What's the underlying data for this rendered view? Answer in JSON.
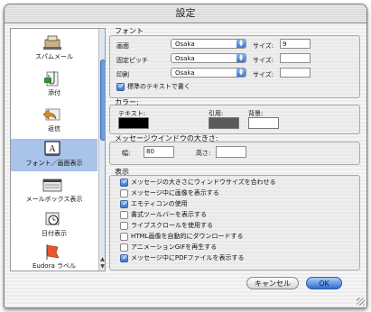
{
  "window": {
    "title": "設定"
  },
  "sidebar": {
    "items": [
      {
        "label": "スパムメール",
        "icon": "spam-icon"
      },
      {
        "label": "添付",
        "icon": "attachment-icon"
      },
      {
        "label": "返信",
        "icon": "reply-icon"
      },
      {
        "label": "フォント／画面表示",
        "icon": "font-display-icon",
        "selected": true
      },
      {
        "label": "メールボックス表示",
        "icon": "mailbox-icon"
      },
      {
        "label": "日付表示",
        "icon": "clock-icon"
      },
      {
        "label": "Eudora ラベル",
        "icon": "label-flag-icon"
      }
    ]
  },
  "font": {
    "heading": "フォント",
    "size_label": "サイズ:",
    "rows": [
      {
        "label": "画面",
        "font": "Osaka",
        "size": "9"
      },
      {
        "label": "固定ピッチ",
        "font": "Osaka",
        "size": ""
      },
      {
        "label": "印刷",
        "font": "Osaka",
        "size": ""
      }
    ],
    "standard_text_checkbox": {
      "label": "標準のテキストで書く",
      "checked": true
    }
  },
  "color": {
    "heading": "カラー:",
    "text_label": "テキスト:",
    "quote_label": "引用:",
    "background_label": "背景:",
    "colors": {
      "text": "#000000",
      "quote": "#5a5a5a",
      "background": "#ffffff"
    }
  },
  "message_window": {
    "heading": "メッセージウインドウの大きさ:",
    "width_label": "幅:",
    "width_value": "80",
    "height_label": "高さ:",
    "height_value": ""
  },
  "display": {
    "heading": "表示",
    "options": [
      {
        "label": "メッセージの大きさにウィンドウサイズを合わせる",
        "checked": true
      },
      {
        "label": "メッセージ中に画像を表示する",
        "checked": false
      },
      {
        "label": "エモティコンの使用",
        "checked": true
      },
      {
        "label": "書式ツールバーを表示する",
        "checked": false
      },
      {
        "label": "ライブスクロールを使用する",
        "checked": false
      },
      {
        "label": "HTML画像を自動的にダウンロードする",
        "checked": false
      },
      {
        "label": "アニメーションGIFを再生する",
        "checked": false
      },
      {
        "label": "メッセージ中にPDFファイルを表示する",
        "checked": true
      }
    ]
  },
  "buttons": {
    "cancel": "キャンセル",
    "ok": "OK"
  },
  "accent_color": "#3b74cf"
}
